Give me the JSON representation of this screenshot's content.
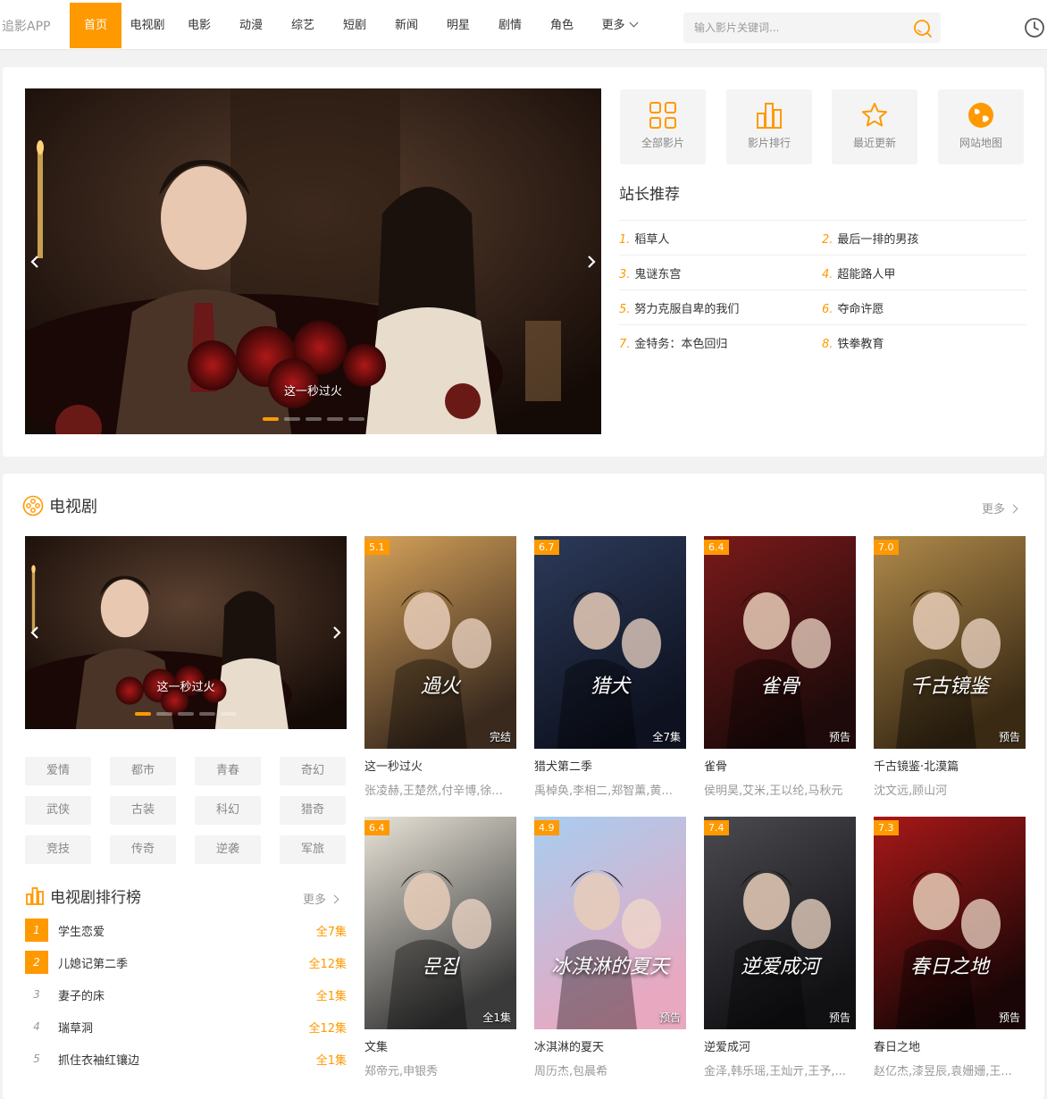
{
  "header": {
    "logo": "追影APP",
    "nav": [
      "首页",
      "电视剧",
      "电影",
      "动漫",
      "综艺",
      "短剧",
      "新闻",
      "明星",
      "剧情",
      "角色"
    ],
    "more": "更多",
    "search_placeholder": "输入影片关键词..."
  },
  "banner": {
    "caption": "这一秒过火",
    "slides": 5,
    "active": 0
  },
  "quick_links": [
    "全部影片",
    "影片排行",
    "最近更新",
    "网站地图"
  ],
  "recommend": {
    "title": "站长推荐",
    "items": [
      {
        "no": "1.",
        "name": "稻草人"
      },
      {
        "no": "2.",
        "name": "最后一排的男孩"
      },
      {
        "no": "3.",
        "name": "鬼谜东宫"
      },
      {
        "no": "4.",
        "name": "超能路人甲"
      },
      {
        "no": "5.",
        "name": "努力克服自卑的我们"
      },
      {
        "no": "6.",
        "name": "夺命许愿"
      },
      {
        "no": "7.",
        "name": "金特务：本色回归"
      },
      {
        "no": "8.",
        "name": "铁拳教育"
      }
    ]
  },
  "tv": {
    "title": "电视剧",
    "more": "更多",
    "mini_banner_caption": "这一秒过火",
    "tags": [
      "爱情",
      "都市",
      "青春",
      "奇幻",
      "武侠",
      "古装",
      "科幻",
      "猎奇",
      "竞技",
      "传奇",
      "逆袭",
      "军旅"
    ],
    "rank": {
      "title": "电视剧排行榜",
      "more": "更多",
      "items": [
        {
          "no": "1",
          "name": "学生恋爱",
          "ep": "全7集"
        },
        {
          "no": "2",
          "name": "儿媳记第二季",
          "ep": "全12集"
        },
        {
          "no": "3",
          "name": "妻子的床",
          "ep": "全1集"
        },
        {
          "no": "4",
          "name": "瑞草洞",
          "ep": "全12集"
        },
        {
          "no": "5",
          "name": "抓住衣袖红镶边",
          "ep": "全1集"
        }
      ]
    },
    "cards": [
      {
        "score": "5.1",
        "badge": "完结",
        "name": "这一秒过火",
        "cast": "张凌赫,王楚然,付辛博,徐...",
        "c1": "#d6a25a",
        "c2": "#3a2a1e",
        "text": "過火"
      },
      {
        "score": "6.7",
        "badge": "全7集",
        "name": "猎犬第二季",
        "cast": "禹棹奂,李相二,郑智薰,黄...",
        "c1": "#2c3a5a",
        "c2": "#0e1220",
        "text": "猎犬"
      },
      {
        "score": "6.4",
        "badge": "预告",
        "name": "雀骨",
        "cast": "侯明昊,艾米,王以纶,马秋元",
        "c1": "#7a1a1a",
        "c2": "#1e0a0a",
        "text": "雀骨"
      },
      {
        "score": "7.0",
        "badge": "预告",
        "name": "千古镜鉴·北漠篇",
        "cast": "沈文远,顾山河",
        "c1": "#b08a4a",
        "c2": "#3a2a14",
        "text": "千古镜鉴"
      },
      {
        "score": "6.4",
        "badge": "全1集",
        "name": "文集",
        "cast": "郑帝元,申银秀",
        "c1": "#e9e4d8",
        "c2": "#3a3a3a",
        "text": "문집"
      },
      {
        "score": "4.9",
        "badge": "预告",
        "name": "冰淇淋的夏天",
        "cast": "周历杰,包晨希",
        "c1": "#a8cdf0",
        "c2": "#e8a8c0",
        "text": "冰淇淋的夏天"
      },
      {
        "score": "7.4",
        "badge": "预告",
        "name": "逆爱成河",
        "cast": "金泽,韩乐瑶,王灿亓,王予,...",
        "c1": "#4a4a50",
        "c2": "#111114",
        "text": "逆爱成河"
      },
      {
        "score": "7.3",
        "badge": "预告",
        "name": "春日之地",
        "cast": "赵亿杰,漆昱辰,袁姗姗,王...",
        "c1": "#a81818",
        "c2": "#1a0606",
        "text": "春日之地"
      }
    ]
  }
}
